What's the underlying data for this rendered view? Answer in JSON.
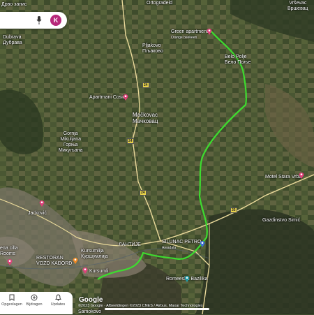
{
  "top": {
    "left_text": "Дрво запис",
    "center_text": "Ortogradeld",
    "right_text": [
      "Vrševac",
      "Вршевац"
    ]
  },
  "search": {
    "avatar": "K",
    "mic_icon": "mic-icon"
  },
  "places": [
    {
      "key": "dubrava",
      "lines": [
        "Dubrava",
        "Дубрава"
      ]
    },
    {
      "key": "pljakovo",
      "lines": [
        "Pljakovo",
        "Пљаково"
      ]
    },
    {
      "key": "green",
      "lines": [
        "Green apartment",
        "Orange beekeen"
      ]
    },
    {
      "key": "belo",
      "lines": [
        "Belo Polje",
        "Бело Поље"
      ]
    },
    {
      "key": "cosic",
      "lines": [
        "Apartmani Cosic"
      ]
    },
    {
      "key": "mackovac",
      "lines": [
        "Mačkovac",
        "Мачковац"
      ]
    },
    {
      "key": "gornja",
      "lines": [
        "Gornja",
        "Mikuljana",
        "Горња",
        "Микуљана"
      ]
    },
    {
      "key": "jackovic",
      "lines": [
        "Jacković"
      ]
    },
    {
      "key": "stara",
      "lines": [
        "Motel Stara Vrba"
      ]
    },
    {
      "key": "gazd",
      "lines": [
        "Gazdinstvo Simić"
      ]
    },
    {
      "key": "silunac",
      "lines": [
        "SILUNAC PETRO",
        "Areadata"
      ]
    },
    {
      "key": "lantije",
      "lines": [
        "ЛАНТИЈЕ"
      ]
    },
    {
      "key": "kursumlija",
      "lines": [
        "Kursumlija",
        "Куршумлија"
      ]
    },
    {
      "key": "restoran",
      "lines": [
        "RESTORAN",
        "VOZD KAĐORĐ"
      ]
    },
    {
      "key": "cilla",
      "lines": [
        "ena cilla",
        "Rooms"
      ]
    },
    {
      "key": "kursum2",
      "lines": [
        "Kursumli"
      ]
    },
    {
      "key": "romeeska",
      "lines": [
        "Romeeska Bazilika"
      ]
    },
    {
      "key": "samokovo",
      "lines": [
        "Samokovo"
      ]
    }
  ],
  "roads": [
    "24",
    "24",
    "24",
    "35"
  ],
  "nav": [
    {
      "label": "Opgeslagen",
      "icon": "bookmark-icon"
    },
    {
      "label": "Bijdragen",
      "icon": "plus-circle-icon"
    },
    {
      "label": "Updates",
      "icon": "bell-icon"
    }
  ],
  "google": "Google",
  "attribution": "©2023 Google · Afbeeldingen ©2023 CNES / Airbus, Maxar Technologies",
  "colors": {
    "route": "#3ddc2f",
    "pin": "#e0407a",
    "road": "#e9d99a"
  }
}
